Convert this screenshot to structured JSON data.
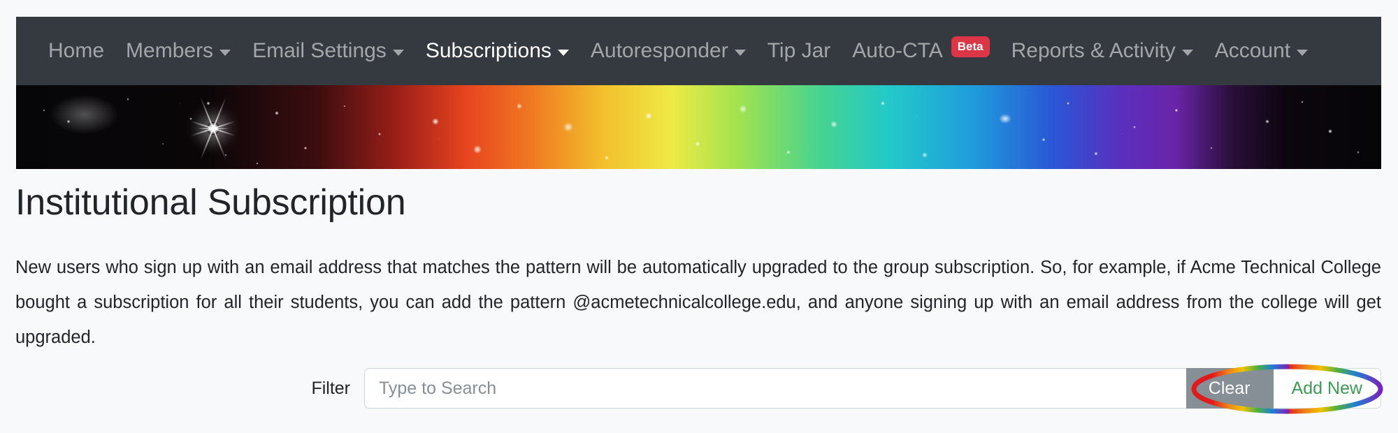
{
  "navbar": {
    "background_color": "#343a40",
    "items": [
      {
        "label": "Home",
        "has_caret": false,
        "active": false
      },
      {
        "label": "Members",
        "has_caret": true,
        "active": false
      },
      {
        "label": "Email Settings",
        "has_caret": true,
        "active": false
      },
      {
        "label": "Subscriptions",
        "has_caret": true,
        "active": true
      },
      {
        "label": "Autoresponder",
        "has_caret": true,
        "active": false
      },
      {
        "label": "Tip Jar",
        "has_caret": false,
        "active": false
      },
      {
        "label": "Auto-CTA",
        "has_caret": false,
        "active": false,
        "badge": "Beta"
      },
      {
        "label": "Reports & Activity",
        "has_caret": true,
        "active": false
      },
      {
        "label": "Account",
        "has_caret": true,
        "active": false
      }
    ],
    "badge_color": "#dc3545"
  },
  "banner": {
    "alt": "space-nebula-rainbow-banner"
  },
  "main": {
    "title": "Institutional Subscription",
    "description": "New users who sign up with an email address that matches the pattern will be automatically upgraded to the group subscription. So, for example, if Acme Technical College bought a subscription for all their students, you can add the pattern @acmetechnicalcollege.edu, and anyone signing up with an email address from the college will get upgraded."
  },
  "filter": {
    "label": "Filter",
    "search_value": "",
    "search_placeholder": "Type to Search",
    "clear_label": "Clear",
    "add_new_label": "Add New",
    "clear_button_color": "#868e96",
    "add_new_text_color": "#3f9a56"
  },
  "annotation": {
    "shape": "rainbow-ellipse",
    "target": "Add New",
    "colors": [
      "#e01b1b",
      "#f07d1a",
      "#f2c200",
      "#4faf3f",
      "#1f7fd4",
      "#7a23b8"
    ]
  },
  "page": {
    "background_color": "#f8f9fa"
  }
}
